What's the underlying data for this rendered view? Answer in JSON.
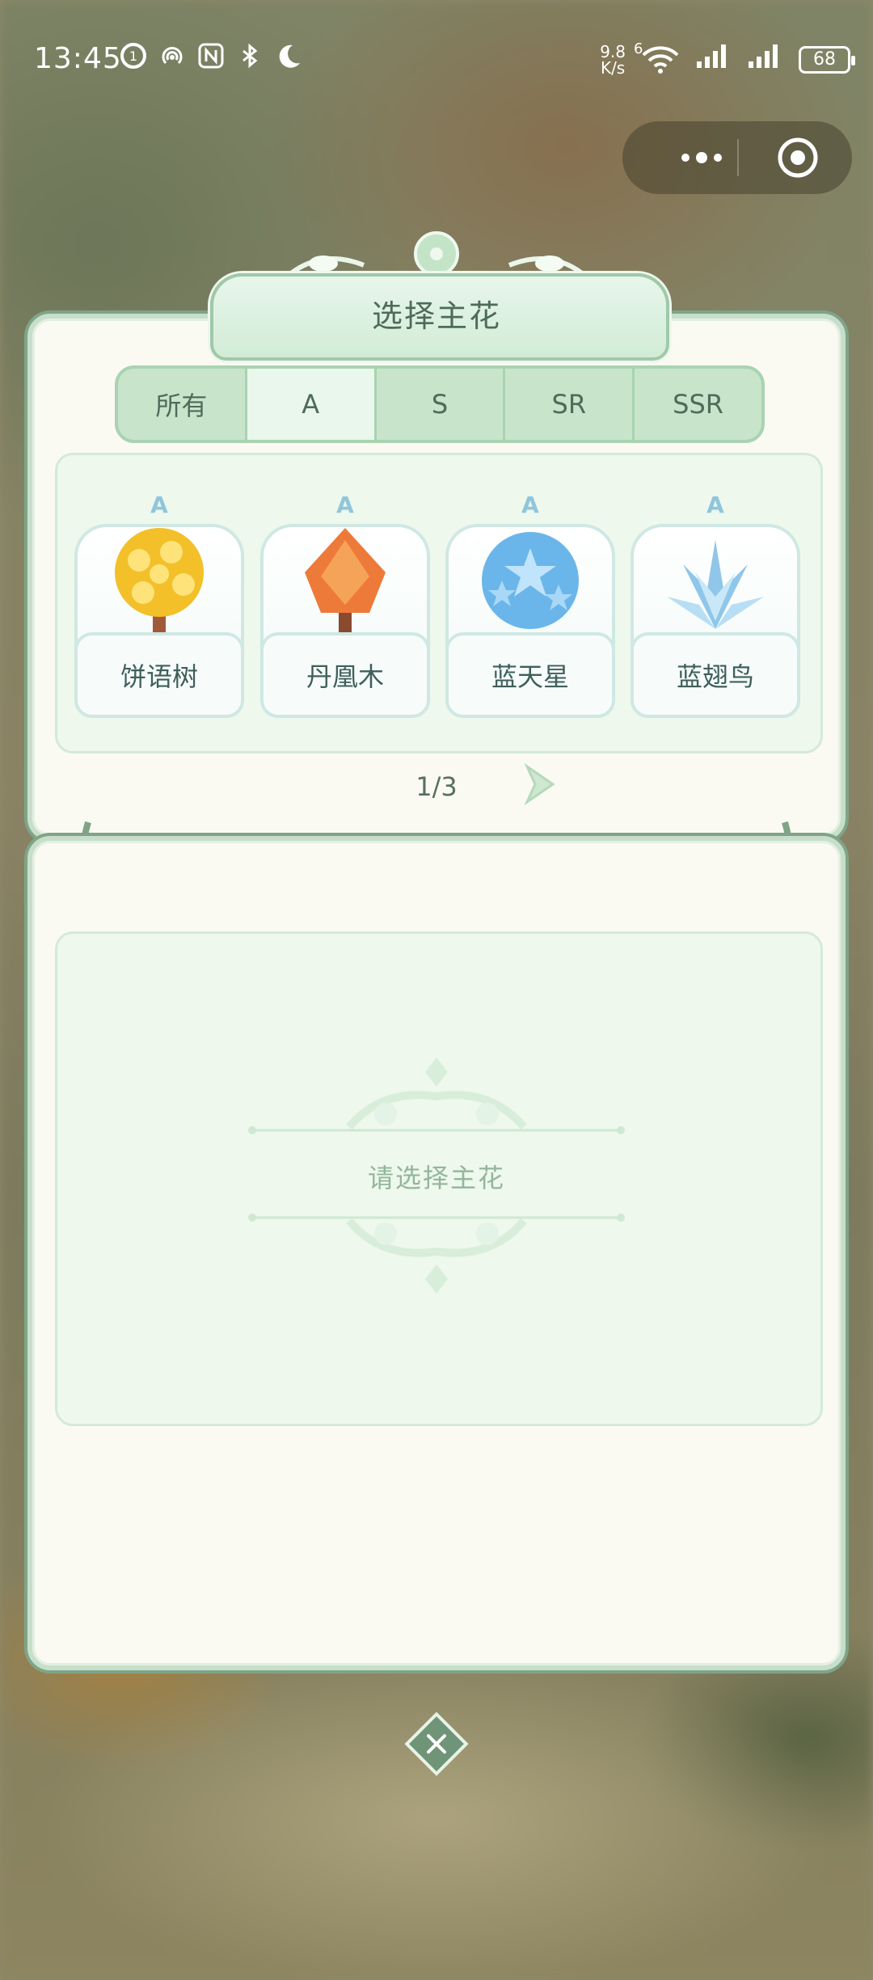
{
  "status_bar": {
    "time": "13:45",
    "net_speed_value": "9.8",
    "net_speed_unit": "K/s",
    "signal_label": "6",
    "battery": "68"
  },
  "dialog": {
    "title": "选择主花",
    "tabs": [
      {
        "label": "所有",
        "selected": false
      },
      {
        "label": "A",
        "selected": true
      },
      {
        "label": "S",
        "selected": false
      },
      {
        "label": "SR",
        "selected": false
      },
      {
        "label": "SSR",
        "selected": false
      }
    ],
    "flowers": [
      {
        "name": "饼语树",
        "grade": "A",
        "color": "#f3c02a"
      },
      {
        "name": "丹凰木",
        "grade": "A",
        "color": "#ee7a3a"
      },
      {
        "name": "蓝天星",
        "grade": "A",
        "color": "#6ab6ea"
      },
      {
        "name": "蓝翅鸟",
        "grade": "A",
        "color": "#8fc6ea"
      }
    ],
    "page_indicator": "1/3",
    "empty_prompt": "请选择主花"
  },
  "colors": {
    "accent_green": "#7fa487",
    "tab_active": "#eaf7ec",
    "panel_bg": "#fbfaf2"
  }
}
